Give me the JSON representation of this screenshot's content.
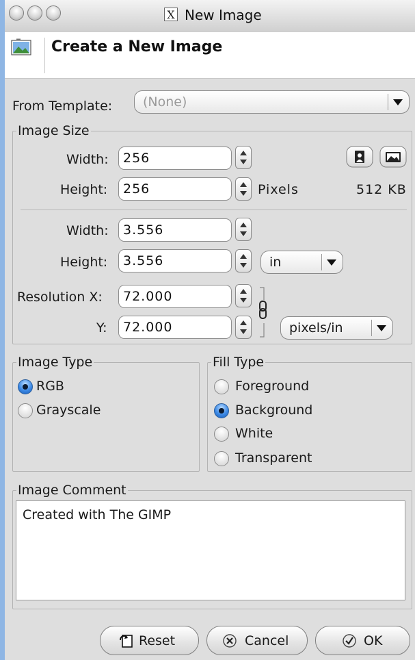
{
  "window": {
    "title": "New Image"
  },
  "header": {
    "title": "Create a New Image"
  },
  "template": {
    "label": "From Template:",
    "value": "(None)"
  },
  "image_size": {
    "legend": "Image Size",
    "width_label": "Width:",
    "width_px": "256",
    "height_label": "Height:",
    "height_px": "256",
    "pixels_label": "Pixels",
    "file_size": "512 KB",
    "width_in": "3.556",
    "height_in": "3.556",
    "unit": "in",
    "res_x_label": "Resolution X:",
    "res_x": "72.000",
    "res_y_label": "Y:",
    "res_y": "72.000",
    "res_unit": "pixels/in"
  },
  "image_type": {
    "legend": "Image Type",
    "options": [
      "RGB",
      "Grayscale"
    ],
    "selected": "RGB"
  },
  "fill_type": {
    "legend": "Fill Type",
    "options": [
      "Foreground",
      "Background",
      "White",
      "Transparent"
    ],
    "selected": "Background"
  },
  "comment": {
    "legend": "Image Comment",
    "text": "Created with The GIMP"
  },
  "buttons": {
    "reset": "Reset",
    "cancel": "Cancel",
    "ok": "OK"
  },
  "colors": {
    "selected_radio": "#3d8ae6",
    "frame": "#8fb6e4",
    "dialog_bg": "#dedede"
  }
}
